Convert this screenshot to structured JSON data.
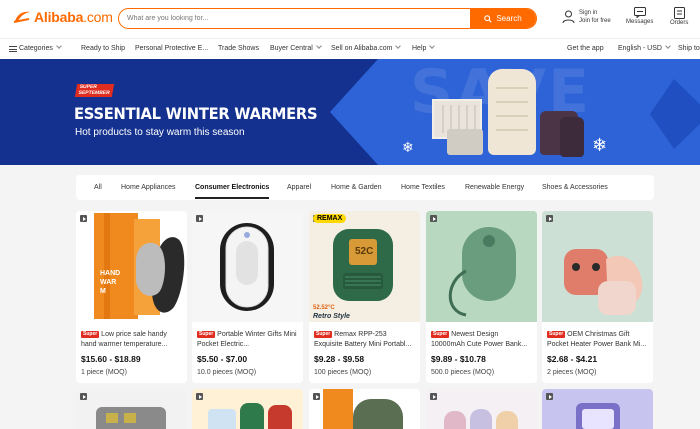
{
  "header": {
    "logo_text": "Alibaba",
    "logo_suffix": ".com",
    "search_placeholder": "What are you looking for...",
    "search_button": "Search",
    "signin_line1": "Sign in",
    "signin_line2": "Join for free",
    "messages_label": "Messages",
    "orders_label": "Orders"
  },
  "nav": {
    "categories": "Categories",
    "ready_to_ship": "Ready to Ship",
    "ppe": "Personal Protective E...",
    "trade_shows": "Trade Shows",
    "buyer_central": "Buyer Central",
    "sell": "Sell on Alibaba.com",
    "help": "Help",
    "get_app": "Get the app",
    "language": "English - USD",
    "ship_to": "Ship to"
  },
  "banner": {
    "badge_line1": "SUPER",
    "badge_line2": "SEPTEMBER",
    "headline": "ESSENTIAL WINTER WARMERS",
    "subheadline": "Hot products to stay warm this season",
    "bg_text": "SAVE"
  },
  "tabs": [
    {
      "label": "All"
    },
    {
      "label": "Home Appliances"
    },
    {
      "label": "Consumer Electronics",
      "active": true
    },
    {
      "label": "Apparel"
    },
    {
      "label": "Home & Garden"
    },
    {
      "label": "Home Textiles"
    },
    {
      "label": "Renewable Energy"
    },
    {
      "label": "Shoes & Accessories"
    }
  ],
  "super_badge": "Super",
  "products": [
    {
      "title": "Low price sale handy hand warmer temperature...",
      "price": "$15.60 - $18.89",
      "moq": "1 piece (MOQ)",
      "image_text": "HAND WARM"
    },
    {
      "title": "Portable Winter Gifts Mini Pocket Electric...",
      "price": "$5.50 - $7.00",
      "moq": "10.0 pieces (MOQ)"
    },
    {
      "title": "Remax RPP-253 Exquisite Battery Mini Portabl...",
      "price": "$9.28 - $9.58",
      "moq": "100 pieces (MOQ)",
      "brand_logo": "REMAX",
      "image_temp": "52.52°C",
      "image_style": "Retro Style",
      "display_text": "52C"
    },
    {
      "title": "Newest Design 10000mAh Cute Power Bank...",
      "price": "$9.89 - $10.78",
      "moq": "500.0 pieces (MOQ)"
    },
    {
      "title": "OEM Christmas Gift Pocket Heater Power Bank Mi...",
      "price": "$2.68 - $4.21",
      "moq": "2 pieces (MOQ)"
    }
  ],
  "colors": {
    "accent": "#ff6a00",
    "banner_bg": "#14318f",
    "super_red": "#e02d20"
  }
}
